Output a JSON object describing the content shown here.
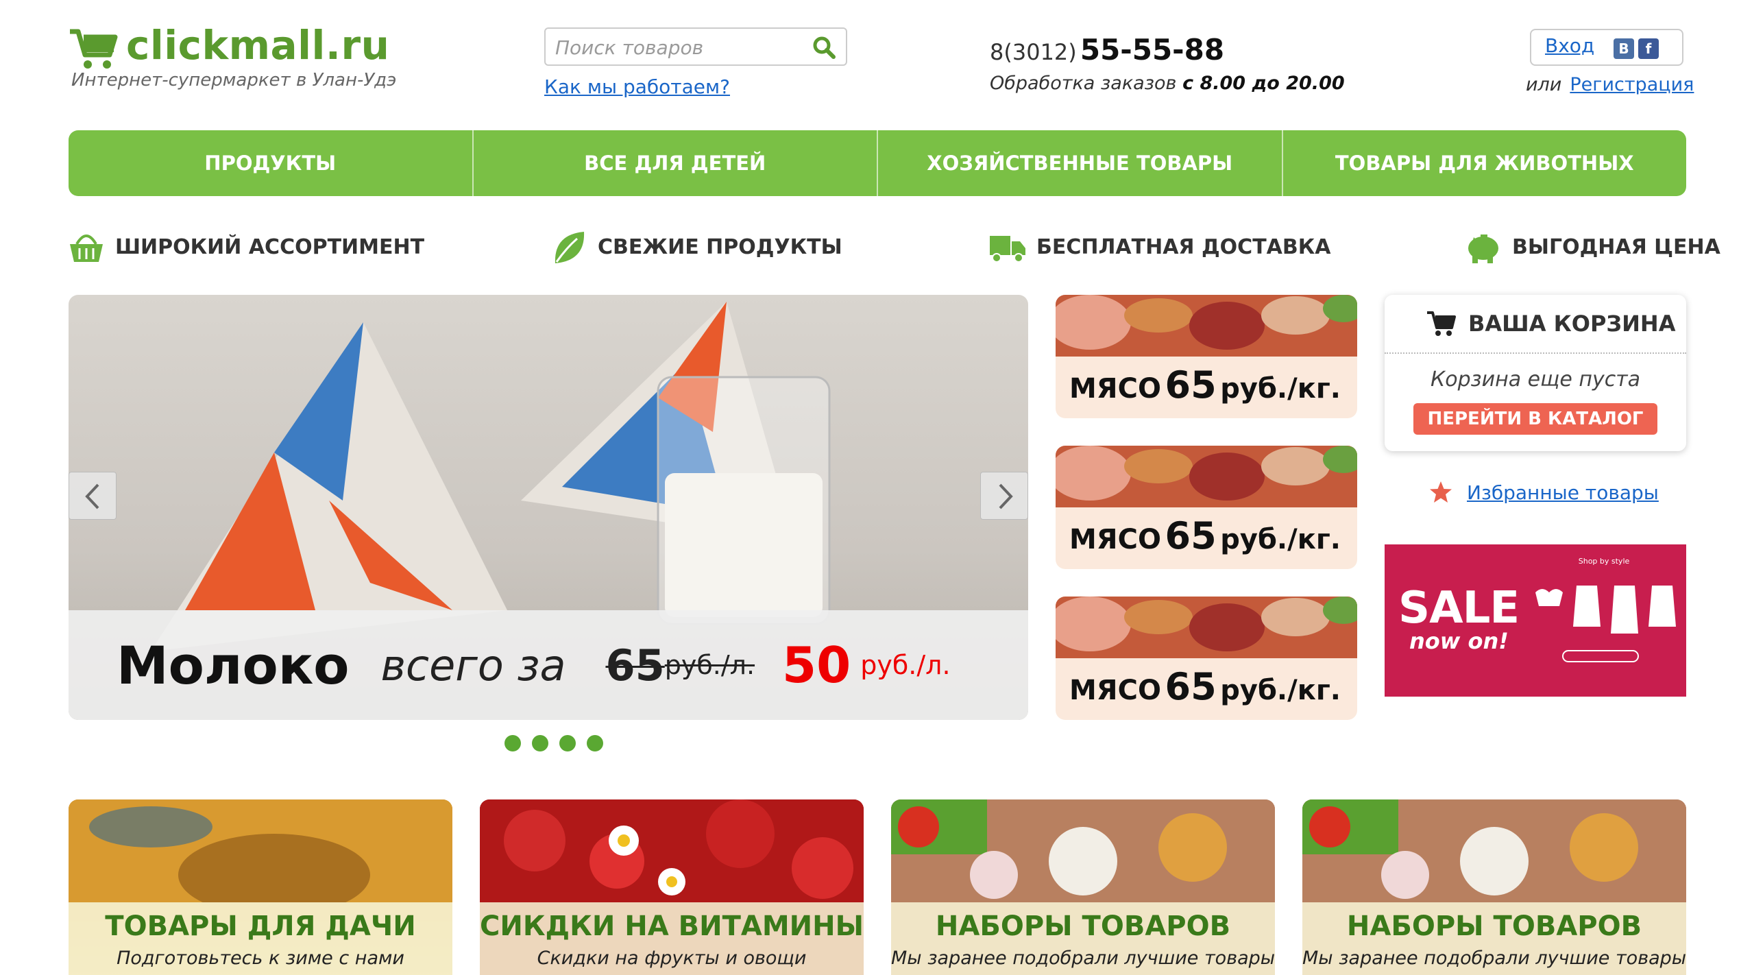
{
  "header": {
    "logo_text": "clickmall.ru",
    "tagline": "Интернет-супермаркет в Улан-Удэ",
    "search_placeholder": "Поиск товаров",
    "how_link": "Как мы работаем?",
    "phone_code": "8(3012)",
    "phone_number": "55-55-88",
    "hours_label": "Обработка заказов",
    "hours_value": "с 8.00 до 20.00",
    "login": "Вход",
    "vk": "В",
    "fb": "f",
    "or": "или",
    "register": "Регистрация"
  },
  "nav": [
    "ПРОДУКТЫ",
    "ВСЕ ДЛЯ ДЕТЕЙ",
    "ХОЗЯЙСТВЕННЫЕ ТОВАРЫ",
    "ТОВАРЫ ДЛЯ ЖИВОТНЫХ"
  ],
  "features": [
    "ШИРОКИЙ АССОРТИМЕНТ",
    "СВЕЖИЕ ПРОДУКТЫ",
    "БЕСПЛАТНАЯ ДОСТАВКА",
    "ВЫГОДНАЯ ЦЕНА"
  ],
  "slider": {
    "title": "Молоко",
    "for": "всего за",
    "old_price": "65",
    "old_unit": "руб./л.",
    "new_price": "50",
    "new_unit": "руб./л.",
    "dots": 4
  },
  "promos": [
    {
      "name": "МЯСО",
      "price": "65",
      "unit": "руб./кг."
    },
    {
      "name": "МЯСО",
      "price": "65",
      "unit": "руб./кг."
    },
    {
      "name": "МЯСО",
      "price": "65",
      "unit": "руб./кг."
    }
  ],
  "cart": {
    "title": "ВАША КОРЗИНА",
    "empty": "Корзина еще пуста",
    "button": "ПЕРЕЙТИ В КАТАЛОГ"
  },
  "favorites": "Избранные товары",
  "sale_banner": {
    "line1": "SALE",
    "line2": "now on!",
    "small": "Shop by style"
  },
  "categories": [
    {
      "title": "ТОВАРЫ ДЛЯ ДАЧИ",
      "subtitle": "Подготовьтесь к зиме с нами"
    },
    {
      "title": "СИКДКИ НА ВИТАМИНЫ",
      "subtitle": "Скидки на фрукты и овощи"
    },
    {
      "title": "НАБОРЫ ТОВАРОВ",
      "subtitle": "Мы заранее подобрали лучшие товары"
    },
    {
      "title": "НАБОРЫ ТОВАРОВ",
      "subtitle": "Мы заранее подобрали лучшие товары"
    }
  ],
  "colors": {
    "brand_green": "#7ac045",
    "link_blue": "#1a66c8",
    "price_red": "#e00000",
    "button_red": "#ee6452"
  }
}
